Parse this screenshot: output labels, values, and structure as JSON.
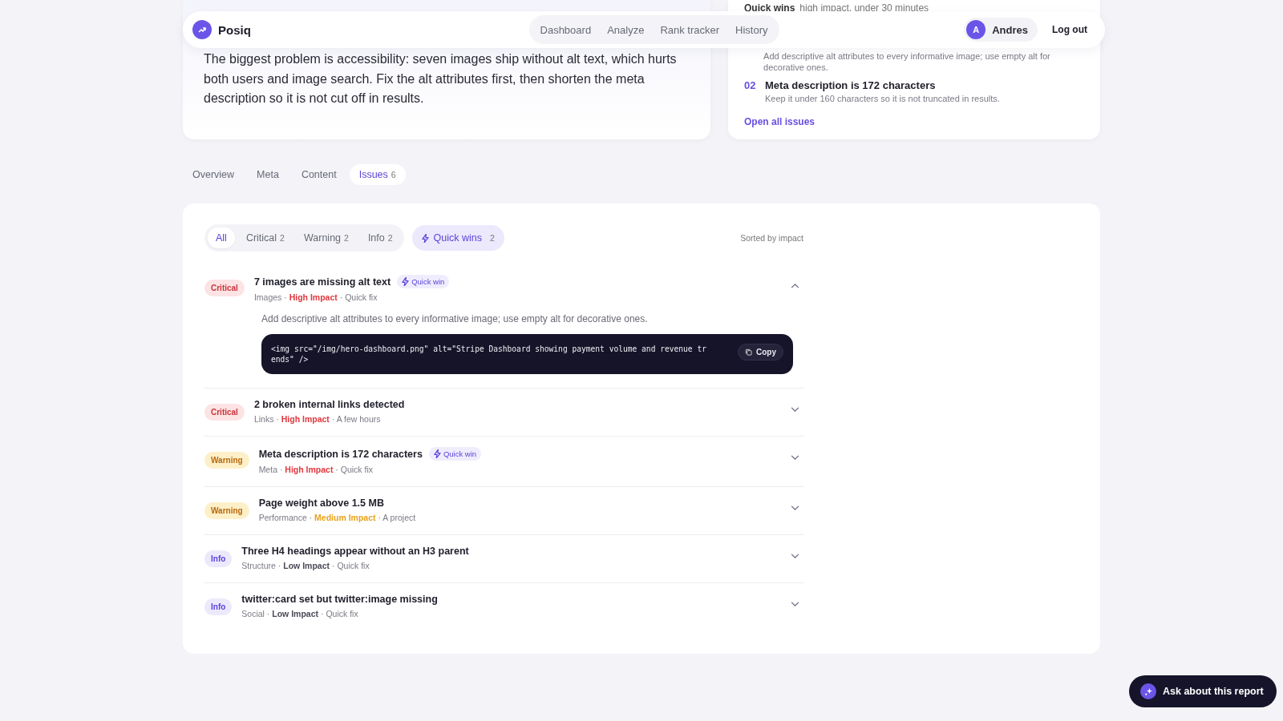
{
  "nav": {
    "brand": "Posiq",
    "links": [
      {
        "label": "Dashboard",
        "selected": false
      },
      {
        "label": "Analyze",
        "selected": false
      },
      {
        "label": "Rank tracker",
        "selected": false
      },
      {
        "label": "History",
        "selected": false
      }
    ],
    "user": {
      "initial": "A",
      "name": "Andres"
    },
    "logout": "Log out"
  },
  "summary": {
    "text": "The biggest problem is accessibility: seven images ship without alt text, which hurts both users and image search. Fix the alt attributes first, then shorten the meta description so it is not cut off in results."
  },
  "quick_wins_card": {
    "heading": "Quick wins",
    "subheading": "high impact, under 30 minutes",
    "items": [
      {
        "description": "Add descriptive alt attributes to every informative image; use empty alt for decorative ones."
      },
      {
        "number": "02",
        "title": "Meta description is 172 characters",
        "description": "Keep it under 160 characters so it is not truncated in results."
      }
    ],
    "link": "Open all issues"
  },
  "tabs": [
    {
      "label": "Overview",
      "selected": false
    },
    {
      "label": "Meta",
      "selected": false
    },
    {
      "label": "Content",
      "selected": false
    },
    {
      "label": "Issues",
      "count": "6",
      "selected": true
    }
  ],
  "filters": [
    {
      "label": "All",
      "selected": true
    },
    {
      "label": "Critical",
      "count": "2",
      "selected": false
    },
    {
      "label": "Warning",
      "count": "2",
      "selected": false
    },
    {
      "label": "Info",
      "count": "2",
      "selected": false
    }
  ],
  "quick_wins_filter": {
    "label": "Quick wins",
    "count": "2",
    "selected": false
  },
  "sort_label": "Sorted by impact",
  "issues": [
    {
      "severity": "Critical",
      "kind": "critical",
      "title": "7 images are missing alt text",
      "quick_win": "Quick win",
      "meta": [
        {
          "text": "Images"
        },
        {
          "text": "·"
        },
        {
          "text": "High Impact",
          "kind": "high"
        },
        {
          "text": "·"
        },
        {
          "text": "Quick fix"
        }
      ],
      "expanded": true,
      "detail": "Add descriptive alt attributes to every informative image; use empty alt for decorative ones.",
      "code": "<img src=\"/img/hero-dashboard.png\" alt=\"Stripe Dashboard showing payment volume and revenue tr\nends\" />",
      "copy": "Copy"
    },
    {
      "severity": "Critical",
      "kind": "critical",
      "title": "2 broken internal links detected",
      "meta": [
        {
          "text": "Links"
        },
        {
          "text": "·"
        },
        {
          "text": "High Impact",
          "kind": "high"
        },
        {
          "text": "·"
        },
        {
          "text": "A few hours"
        }
      ],
      "expanded": false
    },
    {
      "severity": "Warning",
      "kind": "warning",
      "title": "Meta description is 172 characters",
      "quick_win": "Quick win",
      "meta": [
        {
          "text": "Meta"
        },
        {
          "text": "·"
        },
        {
          "text": "High Impact",
          "kind": "high"
        },
        {
          "text": "·"
        },
        {
          "text": "Quick fix"
        }
      ],
      "expanded": false
    },
    {
      "severity": "Warning",
      "kind": "warning",
      "title": "Page weight above 1.5 MB",
      "meta": [
        {
          "text": "Performance"
        },
        {
          "text": "·"
        },
        {
          "text": "Medium Impact",
          "kind": "medium"
        },
        {
          "text": "·"
        },
        {
          "text": "A project"
        }
      ],
      "expanded": false
    },
    {
      "severity": "Info",
      "kind": "info",
      "title": "Three H4 headings appear without an H3 parent",
      "meta": [
        {
          "text": "Structure"
        },
        {
          "text": "·"
        },
        {
          "text": "Low Impact",
          "kind": "low"
        },
        {
          "text": "·"
        },
        {
          "text": "Quick fix"
        }
      ],
      "expanded": false
    },
    {
      "severity": "Info",
      "kind": "info",
      "title": "twitter:card set but twitter:image missing",
      "meta": [
        {
          "text": "Social"
        },
        {
          "text": "·"
        },
        {
          "text": "Low Impact",
          "kind": "low"
        },
        {
          "text": "·"
        },
        {
          "text": "Quick fix"
        }
      ],
      "expanded": false
    }
  ],
  "assistant_button": "Ask about this report"
}
